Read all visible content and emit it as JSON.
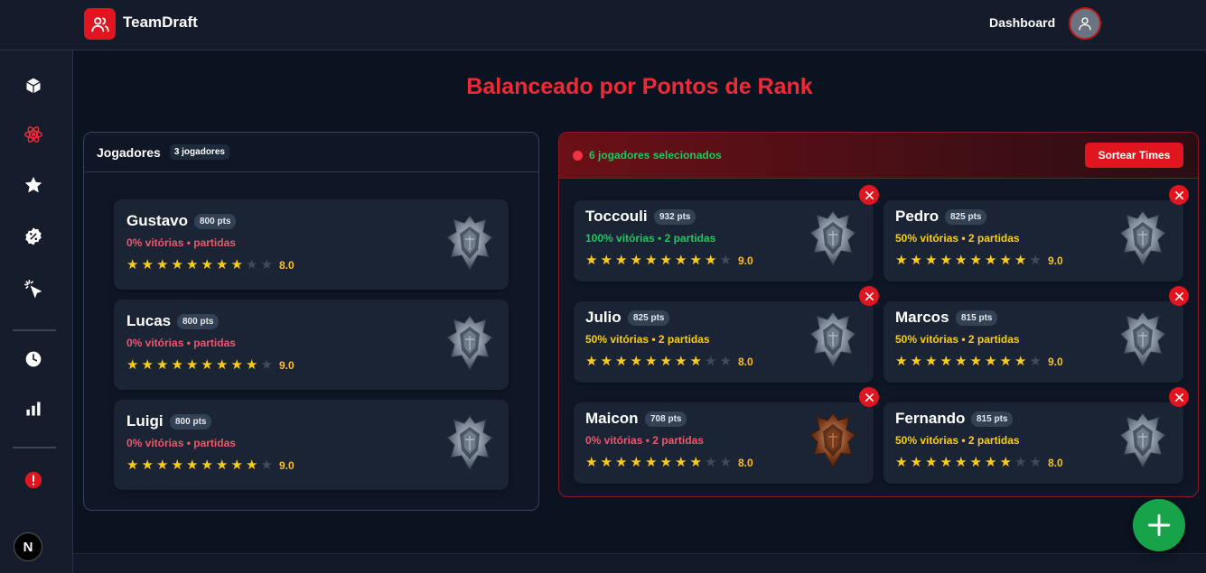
{
  "header": {
    "brand": "TeamDraft",
    "dashboard_label": "Dashboard"
  },
  "sidebar": {
    "icons": [
      "cube-icon",
      "atom-icon",
      "star-icon",
      "percent-badge-icon",
      "click-cursor-icon",
      "clock-icon",
      "bar-chart-icon",
      "alert-icon"
    ],
    "active": "atom-icon",
    "footer_badge": "N"
  },
  "page_title": "Balanceado por Pontos de Rank",
  "players_panel": {
    "label": "Jogadores",
    "count": "3 jogadores",
    "players": [
      {
        "name": "Gustavo",
        "pts": "800 pts",
        "stats": "0% vitórias • partidas",
        "stats_tone": "red",
        "stars": 8,
        "rating": "8.0",
        "emblem": "silver"
      },
      {
        "name": "Lucas",
        "pts": "800 pts",
        "stats": "0% vitórias • partidas",
        "stats_tone": "red",
        "stars": 9,
        "rating": "9.0",
        "emblem": "silver"
      },
      {
        "name": "Luigi",
        "pts": "800 pts",
        "stats": "0% vitórias • partidas",
        "stats_tone": "red",
        "stars": 9,
        "rating": "9.0",
        "emblem": "silver"
      }
    ]
  },
  "selected_panel": {
    "status_text": "6 jogadores selecionados",
    "sort_button": "Sortear Times",
    "players": [
      {
        "name": "Toccouli",
        "pts": "932 pts",
        "stats": "100% vitórias • 2 partidas",
        "stats_tone": "green",
        "stars": 9,
        "rating": "9.0",
        "emblem": "silver"
      },
      {
        "name": "Pedro",
        "pts": "825 pts",
        "stats": "50% vitórias • 2 partidas",
        "stats_tone": "yellow",
        "stars": 9,
        "rating": "9.0",
        "emblem": "silver"
      },
      {
        "name": "Julio",
        "pts": "825 pts",
        "stats": "50% vitórias • 2 partidas",
        "stats_tone": "yellow",
        "stars": 8,
        "rating": "8.0",
        "emblem": "silver"
      },
      {
        "name": "Marcos",
        "pts": "815 pts",
        "stats": "50% vitórias • 2 partidas",
        "stats_tone": "yellow",
        "stars": 9,
        "rating": "9.0",
        "emblem": "silver"
      },
      {
        "name": "Maicon",
        "pts": "708 pts",
        "stats": "0% vitórias • 2 partidas",
        "stats_tone": "red",
        "stars": 8,
        "rating": "8.0",
        "emblem": "bronze"
      },
      {
        "name": "Fernando",
        "pts": "815 pts",
        "stats": "50% vitórias • 2 partidas",
        "stats_tone": "yellow",
        "stars": 8,
        "rating": "8.0",
        "emblem": "silver"
      }
    ]
  },
  "colors": {
    "accent_red": "#e01520",
    "title_red": "#ef2a36",
    "green": "#22c55e",
    "yellow": "#facc15",
    "red_text": "#f0566a",
    "fab_green": "#16a34a"
  },
  "fab_icon": "plus-icon"
}
